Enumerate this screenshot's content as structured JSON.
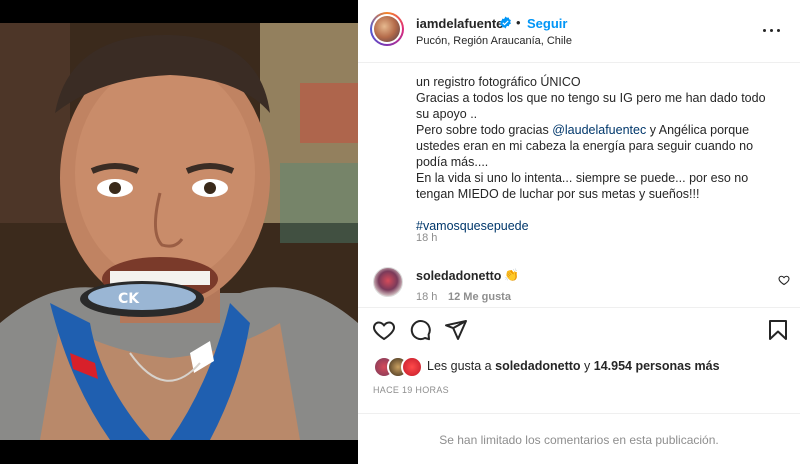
{
  "post": {
    "username": "iamdelafuente",
    "follow_label": "Seguir",
    "location": "Pucón, Región Araucanía, Chile",
    "caption_lines": [
      "un registro fotográfico ÚNICO",
      "Gracias a todos los que no tengo su IG pero me han dado todo su apoyo ..",
      "Pero sobre todo gracias",
      "@laudelafuentec",
      "y Angélica porque ustedes eran en mi cabeza la energía para seguir cuando no podía más....",
      "En la vida si uno lo intenta... siempre se puede... por eso no tengan MIEDO de luchar por sus metas y sueños!!!",
      "#vamosquesepuede"
    ],
    "time": "18 h"
  },
  "comment": {
    "username": "soledadonetto",
    "emoji": "👏",
    "time": "18 h",
    "likes": "12 Me gusta"
  },
  "likes": {
    "prefix": "Les gusta a",
    "user": "soledadonetto",
    "conj": "y",
    "count": "14.954 personas más"
  },
  "posted_ago": "HACE 19 HORAS",
  "comments_limited": "Se han limitado los comentarios en esta publicación.",
  "icons": {
    "verified": "verified-badge-icon",
    "more": "more-options-icon",
    "like": "heart-icon",
    "comment": "comment-icon",
    "share": "share-icon",
    "save": "bookmark-icon"
  },
  "colors": {
    "link": "#0095f6",
    "mention": "#00376b",
    "muted": "#8e8e8e"
  }
}
